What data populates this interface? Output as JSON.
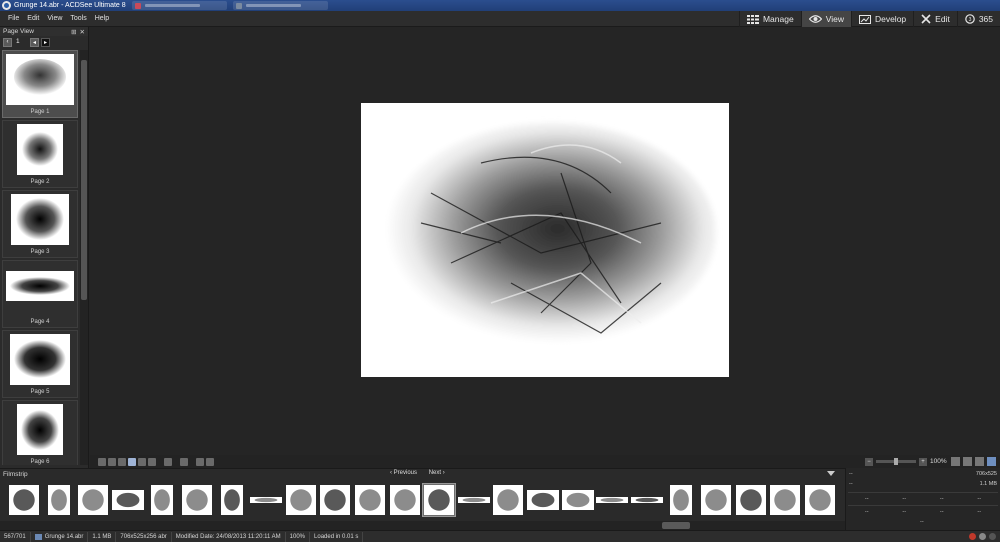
{
  "window": {
    "title": "Grunge 14.abr - ACDSee Ultimate 8"
  },
  "menu": [
    "File",
    "Edit",
    "View",
    "Tools",
    "Help"
  ],
  "modes": [
    {
      "label": "Manage",
      "icon": "grid-icon",
      "active": false
    },
    {
      "label": "View",
      "icon": "eye-icon",
      "active": true
    },
    {
      "label": "Develop",
      "icon": "develop-icon",
      "active": false
    },
    {
      "label": "Edit",
      "icon": "edit-tools-icon",
      "active": false
    },
    {
      "label": "365",
      "icon": "cloud-365-icon",
      "active": false
    }
  ],
  "page_panel": {
    "title": "Page View",
    "page_field": "1",
    "pages": [
      {
        "label": "Page 1",
        "active": true
      },
      {
        "label": "Page 2",
        "active": false
      },
      {
        "label": "Page 3",
        "active": false
      },
      {
        "label": "Page 4",
        "active": false
      },
      {
        "label": "Page 5",
        "active": false
      },
      {
        "label": "Page 6",
        "active": false
      }
    ]
  },
  "zoom": {
    "value": "100%"
  },
  "filmstrip": {
    "title": "Filmstrip",
    "previous": "‹ Previous",
    "next": "Next ›",
    "items": [
      "thumb-1",
      "thumb-2",
      "thumb-3",
      "thumb-4",
      "thumb-5",
      "thumb-6",
      "thumb-7",
      "thumb-8",
      "thumb-9",
      "thumb-10",
      "thumb-11",
      "thumb-12",
      "thumb-13",
      "thumb-14",
      "thumb-15",
      "thumb-16",
      "thumb-17",
      "thumb-18",
      "thumb-19",
      "thumb-20",
      "thumb-21",
      "thumb-22",
      "thumb-23",
      "thumb-24"
    ],
    "selected_index": 12
  },
  "info_panel": {
    "name": "--",
    "dimensions": "706x525",
    "field2": "--",
    "size": "1.1 MB",
    "rows": [
      [
        "--",
        "--",
        "--",
        "--"
      ],
      [
        "--",
        "--",
        "--",
        "--"
      ]
    ],
    "foot": "--"
  },
  "status": {
    "position": "567/701",
    "filename": "Grunge 14.abr",
    "filesize": "1.1 MB",
    "dimensions": "706x525x256 abr",
    "modified": "Modified Date: 24/08/2013 11:20:11 AM",
    "zoom": "100%",
    "loaded": "Loaded in 0.01 s"
  },
  "colors": {
    "titlebar": "#213f78",
    "background": "#252525",
    "panel": "#2b2b2b",
    "accent": "#6e8fc0"
  }
}
